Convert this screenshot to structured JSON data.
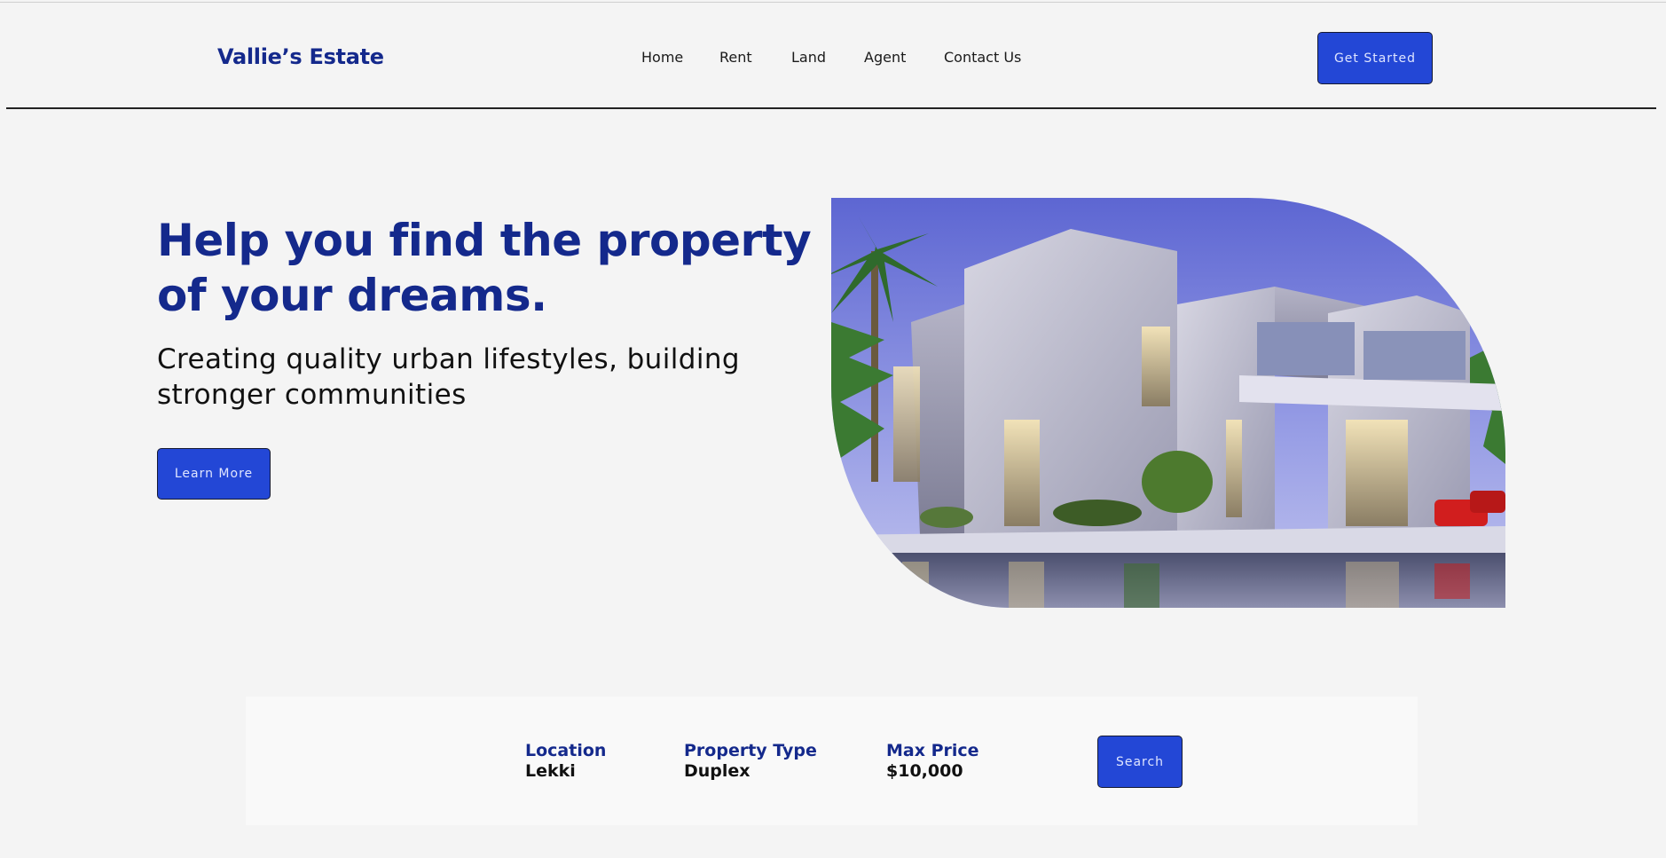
{
  "header": {
    "logo": "Vallie’s Estate",
    "nav": [
      "Home",
      "Rent",
      "Land",
      "Agent",
      "Contact Us"
    ],
    "cta_label": "Get Started"
  },
  "hero": {
    "title": "Help you find the property of your dreams.",
    "subtitle": "Creating quality urban lifestyles, building stronger communities",
    "button_label": "Learn More",
    "image": "modern-villa-photo"
  },
  "search": {
    "fields": [
      {
        "label": "Location",
        "value": "Lekki"
      },
      {
        "label": "Property Type",
        "value": "Duplex"
      },
      {
        "label": "Max Price",
        "value": "$10,000"
      }
    ],
    "button_label": "Search"
  },
  "colors": {
    "brand": "#14298c",
    "button": "#2347d6",
    "background": "#f4f4f4"
  }
}
